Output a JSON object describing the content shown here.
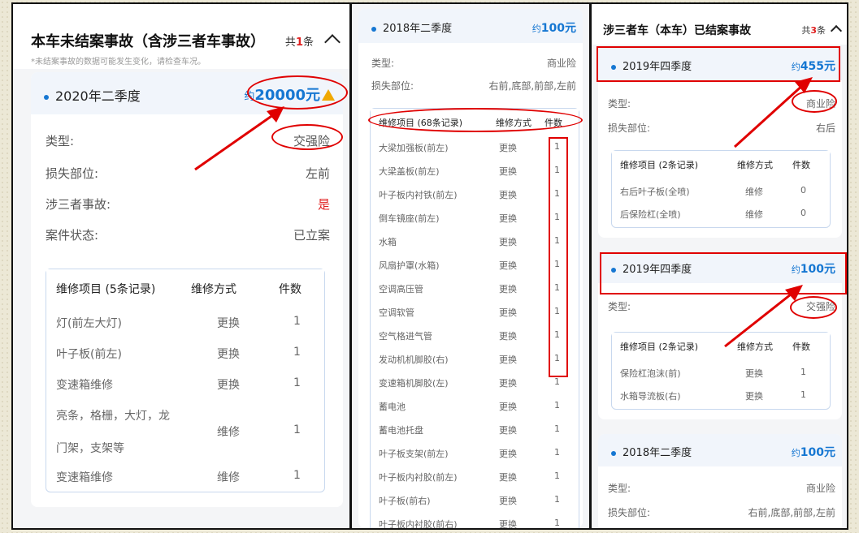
{
  "panel1": {
    "title": "本车未结案事故（含涉三者车事故）",
    "total_prefix": "共",
    "total_count": "1",
    "total_suffix": "条",
    "note": "*未结案事故的数据可能发生变化，请检查车况。",
    "card": {
      "season": "2020年二季度",
      "amount_prefix": "约",
      "amount": "20000元",
      "rows": [
        {
          "label": "类型:",
          "value": "交强险"
        },
        {
          "label": "损失部位:",
          "value": "左前"
        },
        {
          "label": "涉三者事故:",
          "value": "是"
        },
        {
          "label": "案件状态:",
          "value": "已立案"
        }
      ],
      "repair": {
        "headers": [
          "维修项目 (5条记录)",
          "维修方式",
          "件数"
        ],
        "rows": [
          {
            "item": "灯(前左大灯)",
            "method": "更换",
            "count": "1"
          },
          {
            "item": "叶子板(前左)",
            "method": "更换",
            "count": "1"
          },
          {
            "item": "变速箱维修",
            "method": "更换",
            "count": "1"
          },
          {
            "item": "亮条，格栅，大灯，龙",
            "item2": "门架，支架等",
            "method": "维修",
            "count": "1"
          },
          {
            "item": "变速箱维修",
            "method": "维修",
            "count": "1"
          }
        ]
      }
    }
  },
  "panel2": {
    "card": {
      "season": "2018年二季度",
      "amount_prefix": "约",
      "amount": "100元",
      "rows": [
        {
          "label": "类型:",
          "value": "商业险"
        },
        {
          "label": "损失部位:",
          "value": "右前,底部,前部,左前"
        }
      ],
      "repair": {
        "headers": [
          "维修项目 (68条记录)",
          "维修方式",
          "件数"
        ],
        "rows": [
          {
            "item": "大梁加强板(前左)",
            "method": "更换",
            "count": "1"
          },
          {
            "item": "大梁盖板(前左)",
            "method": "更换",
            "count": "1"
          },
          {
            "item": "叶子板内衬铁(前左)",
            "method": "更换",
            "count": "1"
          },
          {
            "item": "倒车镜座(前左)",
            "method": "更换",
            "count": "1"
          },
          {
            "item": "水箱",
            "method": "更换",
            "count": "1"
          },
          {
            "item": "风扇护罩(水箱)",
            "method": "更换",
            "count": "1"
          },
          {
            "item": "空调高压管",
            "method": "更换",
            "count": "1"
          },
          {
            "item": "空调软管",
            "method": "更换",
            "count": "1"
          },
          {
            "item": "空气格进气管",
            "method": "更换",
            "count": "1"
          },
          {
            "item": "发动机机脚胶(右)",
            "method": "更换",
            "count": "1"
          },
          {
            "item": "变速箱机脚胶(左)",
            "method": "更换",
            "count": "1"
          },
          {
            "item": "蓄电池",
            "method": "更换",
            "count": "1"
          },
          {
            "item": "蓄电池托盘",
            "method": "更换",
            "count": "1"
          },
          {
            "item": "叶子板支架(前左)",
            "method": "更换",
            "count": "1"
          },
          {
            "item": "叶子板内衬胶(前左)",
            "method": "更换",
            "count": "1"
          },
          {
            "item": "叶子板(前右)",
            "method": "更换",
            "count": "1"
          },
          {
            "item": "叶子板内衬胶(前右)",
            "method": "更换",
            "count": "1"
          }
        ]
      }
    }
  },
  "panel3": {
    "title": "涉三者车（本车）已结案事故",
    "total_prefix": "共",
    "total_count": "3",
    "total_suffix": "条",
    "cards": [
      {
        "season": "2019年四季度",
        "amount_prefix": "约",
        "amount": "455元",
        "rows": [
          {
            "label": "类型:",
            "value": "商业险"
          },
          {
            "label": "损失部位:",
            "value": "右后"
          }
        ],
        "repair": {
          "headers": [
            "维修项目 (2条记录)",
            "维修方式",
            "件数"
          ],
          "rows": [
            {
              "item": "右后叶子板(全喷)",
              "method": "维修",
              "count": "0"
            },
            {
              "item": "后保险杠(全喷)",
              "method": "维修",
              "count": "0"
            }
          ]
        }
      },
      {
        "season": "2019年四季度",
        "amount_prefix": "约",
        "amount": "100元",
        "rows": [
          {
            "label": "类型:",
            "value": "交强险"
          }
        ],
        "repair": {
          "headers": [
            "维修项目 (2条记录)",
            "维修方式",
            "件数"
          ],
          "rows": [
            {
              "item": "保险杠泡沫(前)",
              "method": "更换",
              "count": "1"
            },
            {
              "item": "水箱导流板(右)",
              "method": "更换",
              "count": "1"
            }
          ]
        }
      },
      {
        "season": "2018年二季度",
        "amount_prefix": "约",
        "amount": "100元",
        "rows": [
          {
            "label": "类型:",
            "value": "商业险"
          },
          {
            "label": "损失部位:",
            "value": "右前,底部,前部,左前"
          }
        ]
      }
    ]
  },
  "colors": {
    "accent_blue": "#1677d2",
    "alert_red": "#e02020",
    "annotation_red": "#e00000",
    "warning_yellow": "#f0a800"
  }
}
